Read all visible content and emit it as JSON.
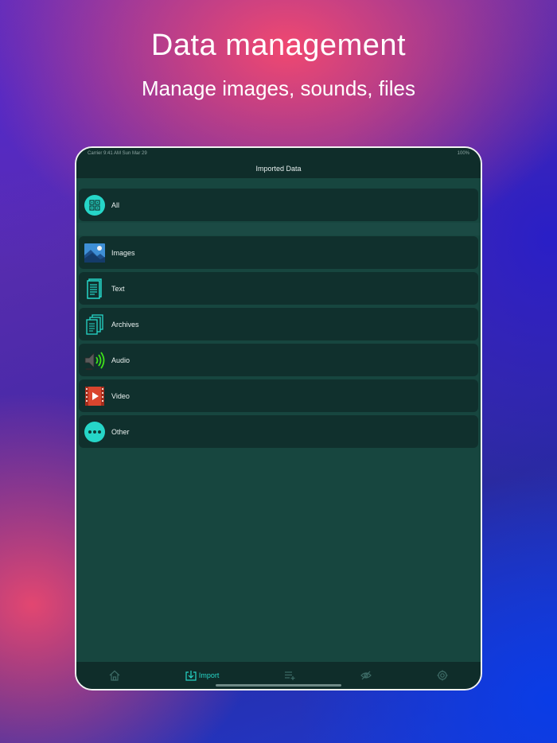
{
  "hero": {
    "title": "Data management",
    "subtitle": "Manage images, sounds, files"
  },
  "status_bar": {
    "left": "Carrier  9:41 AM  Sun Mar 29",
    "right": "100%"
  },
  "nav": {
    "title": "Imported Data"
  },
  "rows": [
    {
      "label": "All",
      "icon": "all-grid-icon"
    },
    {
      "label": "Images",
      "icon": "image-icon"
    },
    {
      "label": "Text",
      "icon": "text-document-icon"
    },
    {
      "label": "Archives",
      "icon": "archives-icon"
    },
    {
      "label": "Audio",
      "icon": "speaker-icon"
    },
    {
      "label": "Video",
      "icon": "video-icon"
    },
    {
      "label": "Other",
      "icon": "more-icon"
    }
  ],
  "tabs": [
    {
      "label": "",
      "icon": "home-icon"
    },
    {
      "label": "Import",
      "icon": "import-icon",
      "active": true
    },
    {
      "label": "",
      "icon": "list-add-icon"
    },
    {
      "label": "",
      "icon": "hidden-icon"
    },
    {
      "label": "",
      "icon": "gear-icon"
    }
  ],
  "colors": {
    "accent": "#26d6c8",
    "row_background": "#10302d",
    "content_background": "#17463f"
  }
}
